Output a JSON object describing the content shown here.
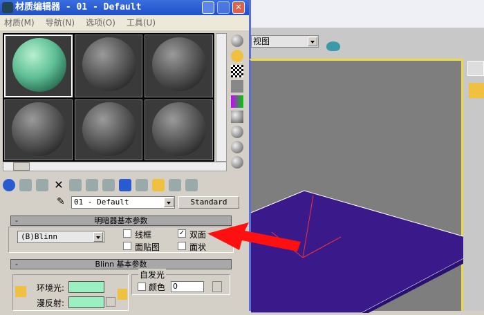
{
  "window": {
    "title": "材质编辑器 - 01 - Default"
  },
  "menu": [
    "材质(M)",
    "导航(N)",
    "选项(O)",
    "工具(U)"
  ],
  "material_name": "01 - Default",
  "material_type": "Standard",
  "shader_rollout": {
    "title": "明暗器基本参数",
    "shader": "(B)Blinn",
    "wire": "线框",
    "two_sided": "双面",
    "face_map": "面贴图",
    "faceted": "面状",
    "two_sided_checked": true
  },
  "blinn_rollout": {
    "title": "Blinn 基本参数",
    "ambient": "环境光:",
    "diffuse": "漫反射:",
    "self_illum": "自发光",
    "color": "颜色",
    "illum_value": "0"
  },
  "viewport": {
    "view_label": "视图"
  },
  "colors": {
    "ambient": "#9af0c0",
    "plane": "#3a1a8a",
    "arrow": "#ff1010"
  }
}
